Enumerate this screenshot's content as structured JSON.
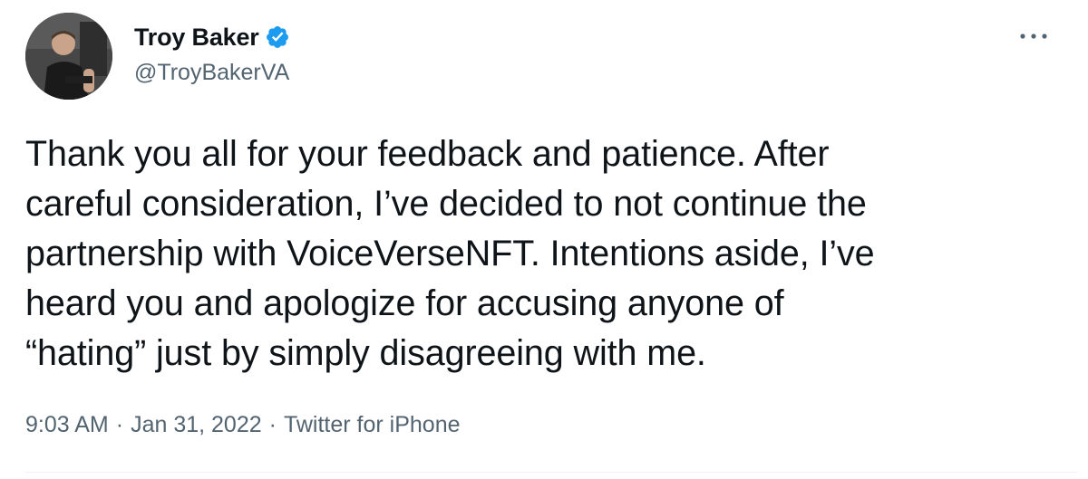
{
  "author": {
    "display_name": "Troy Baker",
    "handle": "@TroyBakerVA",
    "verified": true,
    "avatar_icon": "user-avatar-photo"
  },
  "tweet": {
    "text": "Thank you all for your feedback and patience. After\ncareful consideration, I’ve decided to not continue the\npartnership with VoiceVerseNFT. Intentions aside, I’ve\nheard you and apologize for accusing anyone of\n“hating” just by simply disagreeing with me.",
    "time": "9:03 AM",
    "date": "Jan 31, 2022",
    "source": "Twitter for iPhone",
    "separator": "·"
  },
  "colors": {
    "text_primary": "#0f1419",
    "text_secondary": "#536471",
    "verified_blue": "#1d9bf0",
    "divider": "#eff3f4"
  },
  "icons": {
    "verified": "verified-badge-icon",
    "more": "more-options-icon"
  }
}
